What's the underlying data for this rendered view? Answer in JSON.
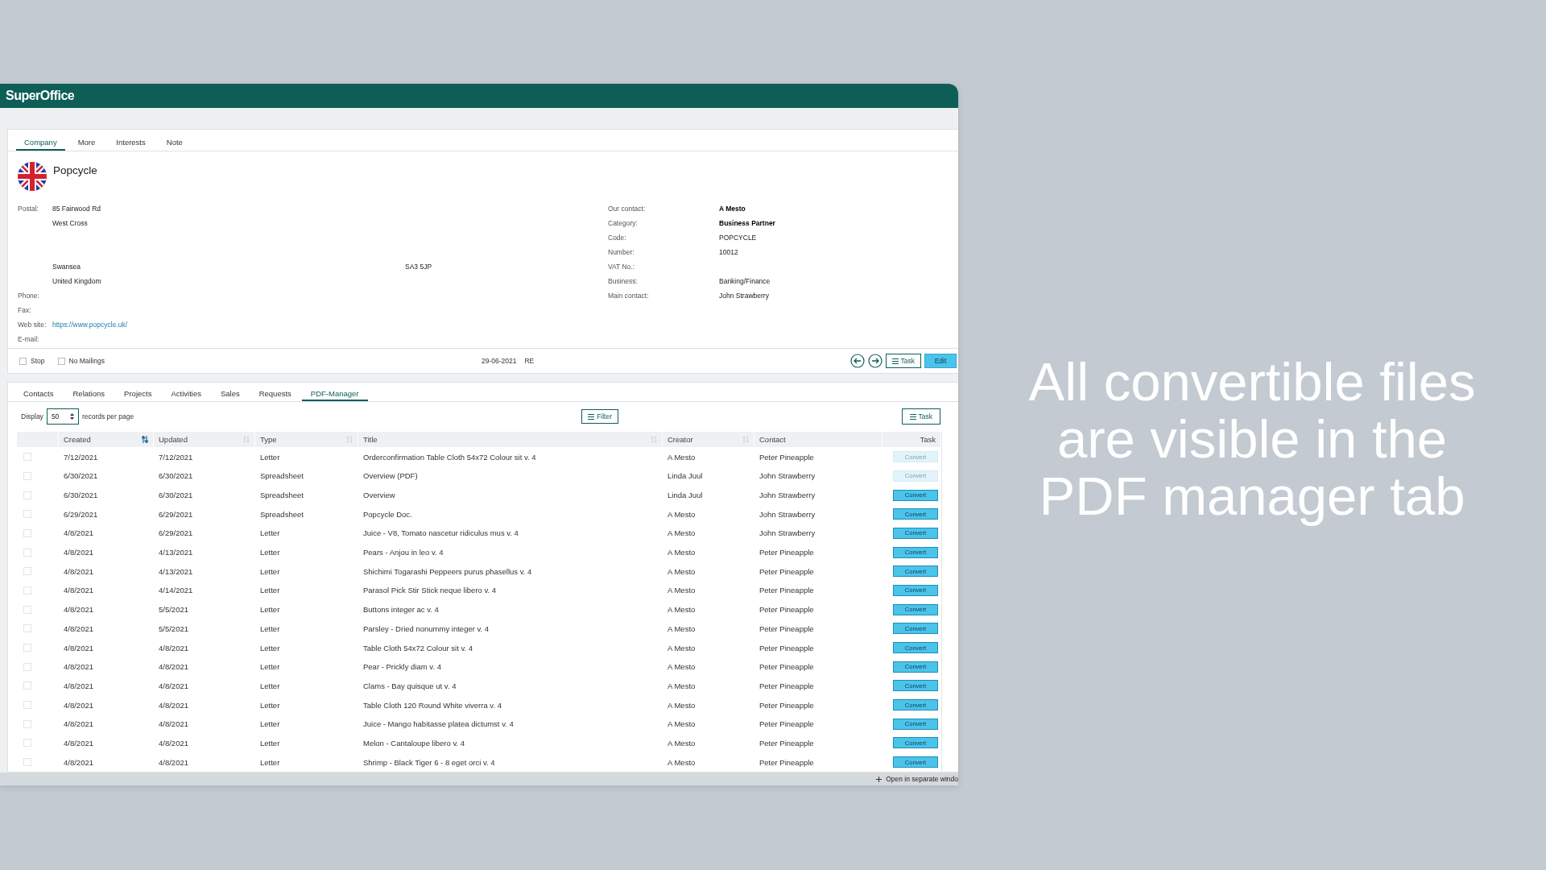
{
  "app": {
    "logo": "SuperOffice"
  },
  "company_tabs": [
    {
      "label": "Company",
      "selected": true
    },
    {
      "label": "More",
      "selected": false
    },
    {
      "label": "Interests",
      "selected": false
    },
    {
      "label": "Note",
      "selected": false
    }
  ],
  "company": {
    "name": "Popcycle",
    "address": {
      "label": "Postal:",
      "lines": [
        "85 Fairwood Rd",
        "West Cross"
      ],
      "city": "Swansea",
      "postcode": "SA3 5JP",
      "country": "United Kingdom"
    },
    "contact_fields": [
      {
        "label": "Phone:"
      },
      {
        "label": "Fax:"
      },
      {
        "label": "Web site:",
        "value": "https://www.popcycle.uk/",
        "kind": "link"
      },
      {
        "label": "E-mail:"
      }
    ],
    "details": [
      {
        "label": "Our contact:",
        "value": "A Mesto",
        "bold": true
      },
      {
        "label": "Category:",
        "value": "Business Partner",
        "bold": true
      },
      {
        "label": "Code:",
        "value": "POPCYCLE",
        "bold": false
      },
      {
        "label": "Number:",
        "value": "10012",
        "bold": false
      },
      {
        "label": "VAT No.:"
      },
      {
        "label": "Business:",
        "value": "Banking/Finance",
        "bold": false
      },
      {
        "label": "Main contact:",
        "value": "John Strawberry",
        "bold": false
      }
    ]
  },
  "footer": {
    "checkboxes": [
      {
        "label": "Stop",
        "checked": false
      },
      {
        "label": "No Mailings",
        "checked": false
      }
    ],
    "date": "29-06-2021",
    "initials": "RE",
    "task_button": "Task",
    "edit_button": "Edit"
  },
  "record_tabs": [
    {
      "label": "Contacts",
      "selected": false
    },
    {
      "label": "Relations",
      "selected": false
    },
    {
      "label": "Projects",
      "selected": false
    },
    {
      "label": "Activities",
      "selected": false
    },
    {
      "label": "Sales",
      "selected": false
    },
    {
      "label": "Requests",
      "selected": false
    },
    {
      "label": "PDF-Manager",
      "selected": true
    }
  ],
  "list": {
    "display_label": "Display",
    "page_size": "50",
    "per_page_label": "records per page",
    "filter_button": "Filter",
    "task_button": "Task",
    "columns": [
      {
        "label": "Created",
        "kind": "sortable",
        "sorted": true
      },
      {
        "label": "Updated",
        "kind": "sortable",
        "sorted": false
      },
      {
        "label": "Type",
        "kind": "sortable",
        "sorted": false
      },
      {
        "label": "Title",
        "kind": "sortable",
        "sorted": false
      },
      {
        "label": "Creator",
        "kind": "sortable",
        "sorted": false
      },
      {
        "label": "Contact",
        "kind": "plain",
        "sorted": false
      },
      {
        "label": "Task",
        "kind": "plain",
        "sorted": false
      }
    ],
    "rows": [
      {
        "checked": false,
        "created": "7/12/2021",
        "updated": "7/12/2021",
        "type": "Letter",
        "title": "Orderconfirmation Table Cloth 54x72 Colour sit v. 4",
        "creator": "A Mesto",
        "contact": "Peter Pineapple",
        "button": "Convert",
        "disabled": true
      },
      {
        "checked": false,
        "created": "6/30/2021",
        "updated": "6/30/2021",
        "type": "Spreadsheet",
        "title": "Overview (PDF)",
        "creator": "Linda Juul",
        "contact": "John Strawberry",
        "button": "Convert",
        "disabled": true
      },
      {
        "checked": false,
        "created": "6/30/2021",
        "updated": "6/30/2021",
        "type": "Spreadsheet",
        "title": "Overview",
        "creator": "Linda Juul",
        "contact": "John Strawberry",
        "button": "Convert",
        "disabled": false
      },
      {
        "checked": false,
        "created": "6/29/2021",
        "updated": "6/29/2021",
        "type": "Spreadsheet",
        "title": "Popcycle Doc.",
        "creator": "A Mesto",
        "contact": "John Strawberry",
        "button": "Convert",
        "disabled": false
      },
      {
        "checked": false,
        "created": "4/8/2021",
        "updated": "6/29/2021",
        "type": "Letter",
        "title": "Juice - V8, Tomato nascetur ridiculus mus v. 4",
        "creator": "A Mesto",
        "contact": "John Strawberry",
        "button": "Convert",
        "disabled": false
      },
      {
        "checked": false,
        "created": "4/8/2021",
        "updated": "4/13/2021",
        "type": "Letter",
        "title": "Pears - Anjou in leo v. 4",
        "creator": "A Mesto",
        "contact": "Peter Pineapple",
        "button": "Convert",
        "disabled": false
      },
      {
        "checked": false,
        "created": "4/8/2021",
        "updated": "4/13/2021",
        "type": "Letter",
        "title": "Shichimi Togarashi Peppeers purus phasellus v. 4",
        "creator": "A Mesto",
        "contact": "Peter Pineapple",
        "button": "Convert",
        "disabled": false
      },
      {
        "checked": false,
        "created": "4/8/2021",
        "updated": "4/14/2021",
        "type": "Letter",
        "title": "Parasol Pick Stir Stick neque libero v. 4",
        "creator": "A Mesto",
        "contact": "Peter Pineapple",
        "button": "Convert",
        "disabled": false
      },
      {
        "checked": false,
        "created": "4/8/2021",
        "updated": "5/5/2021",
        "type": "Letter",
        "title": "Buttons integer ac v. 4",
        "creator": "A Mesto",
        "contact": "Peter Pineapple",
        "button": "Convert",
        "disabled": false
      },
      {
        "checked": false,
        "created": "4/8/2021",
        "updated": "5/5/2021",
        "type": "Letter",
        "title": "Parsley - Dried nonummy integer v. 4",
        "creator": "A Mesto",
        "contact": "Peter Pineapple",
        "button": "Convert",
        "disabled": false
      },
      {
        "checked": false,
        "created": "4/8/2021",
        "updated": "4/8/2021",
        "type": "Letter",
        "title": "Table Cloth 54x72 Colour sit v. 4",
        "creator": "A Mesto",
        "contact": "Peter Pineapple",
        "button": "Convert",
        "disabled": false
      },
      {
        "checked": false,
        "created": "4/8/2021",
        "updated": "4/8/2021",
        "type": "Letter",
        "title": "Pear - Prickly diam v. 4",
        "creator": "A Mesto",
        "contact": "Peter Pineapple",
        "button": "Convert",
        "disabled": false
      },
      {
        "checked": false,
        "created": "4/8/2021",
        "updated": "4/8/2021",
        "type": "Letter",
        "title": "Clams - Bay quisque ut v. 4",
        "creator": "A Mesto",
        "contact": "Peter Pineapple",
        "button": "Convert",
        "disabled": false
      },
      {
        "checked": false,
        "created": "4/8/2021",
        "updated": "4/8/2021",
        "type": "Letter",
        "title": "Table Cloth 120 Round White viverra v. 4",
        "creator": "A Mesto",
        "contact": "Peter Pineapple",
        "button": "Convert",
        "disabled": false
      },
      {
        "checked": false,
        "created": "4/8/2021",
        "updated": "4/8/2021",
        "type": "Letter",
        "title": "Juice - Mango habitasse platea dictumst v. 4",
        "creator": "A Mesto",
        "contact": "Peter Pineapple",
        "button": "Convert",
        "disabled": false
      },
      {
        "checked": false,
        "created": "4/8/2021",
        "updated": "4/8/2021",
        "type": "Letter",
        "title": "Melon - Cantaloupe libero v. 4",
        "creator": "A Mesto",
        "contact": "Peter Pineapple",
        "button": "Convert",
        "disabled": false
      },
      {
        "checked": false,
        "created": "4/8/2021",
        "updated": "4/8/2021",
        "type": "Letter",
        "title": "Shrimp - Black Tiger 6 - 8 eget orci v. 4",
        "creator": "A Mesto",
        "contact": "Peter Pineapple",
        "button": "Convert",
        "disabled": false
      }
    ]
  },
  "open_window_link": "Open in separate windo",
  "caption": "All convertible files are visible in the PDF manager tab"
}
